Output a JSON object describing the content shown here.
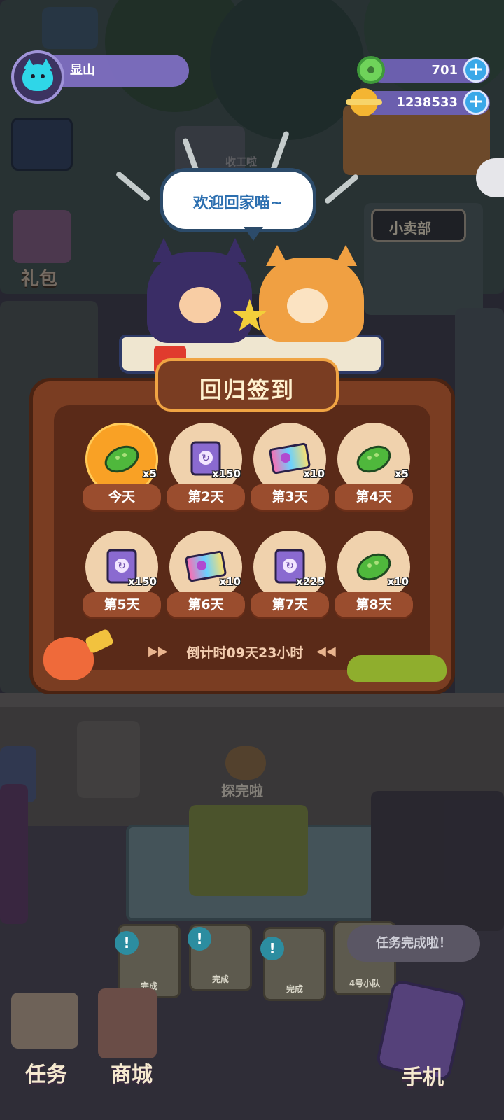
{
  "profile": {
    "name": "显山",
    "avatar_icon": "blue-cat-avatar-icon"
  },
  "currencies": [
    {
      "name": "gem",
      "icon": "green-donut-icon",
      "value": "701"
    },
    {
      "name": "coin",
      "icon": "golden-planet-icon",
      "value": "1238533"
    }
  ],
  "bubble": {
    "text": "欢迎回家喵~"
  },
  "background": {
    "labels": {
      "gift": "礼包",
      "kiosk": "小卖部",
      "explore": "探完啦",
      "receive": "收工啦"
    }
  },
  "panel": {
    "title": "回归签到",
    "rewards": [
      {
        "day": "今天",
        "qty": "x5",
        "item": "cucumber",
        "today": true
      },
      {
        "day": "第2天",
        "qty": "x150",
        "item": "purple-book"
      },
      {
        "day": "第3天",
        "qty": "x10",
        "item": "rainbow-ticket"
      },
      {
        "day": "第4天",
        "qty": "x5",
        "item": "cucumber"
      },
      {
        "day": "第5天",
        "qty": "x150",
        "item": "purple-book"
      },
      {
        "day": "第6天",
        "qty": "x10",
        "item": "rainbow-ticket"
      },
      {
        "day": "第7天",
        "qty": "x225",
        "item": "purple-book"
      },
      {
        "day": "第8天",
        "qty": "x10",
        "item": "cucumber"
      }
    ],
    "countdown": "倒计时09天23小时"
  },
  "bottom": {
    "toast": "任务完成啦！",
    "tasks_label": "任务",
    "shop_label": "商城",
    "phone_label": "手机",
    "cards": [
      "完成",
      "完成",
      "完成",
      "4号小队"
    ]
  },
  "colors": {
    "panel": "#7a3d22",
    "title_border": "#f0a443",
    "today": "#f9a125",
    "accent_blue": "#3aa8e8"
  }
}
